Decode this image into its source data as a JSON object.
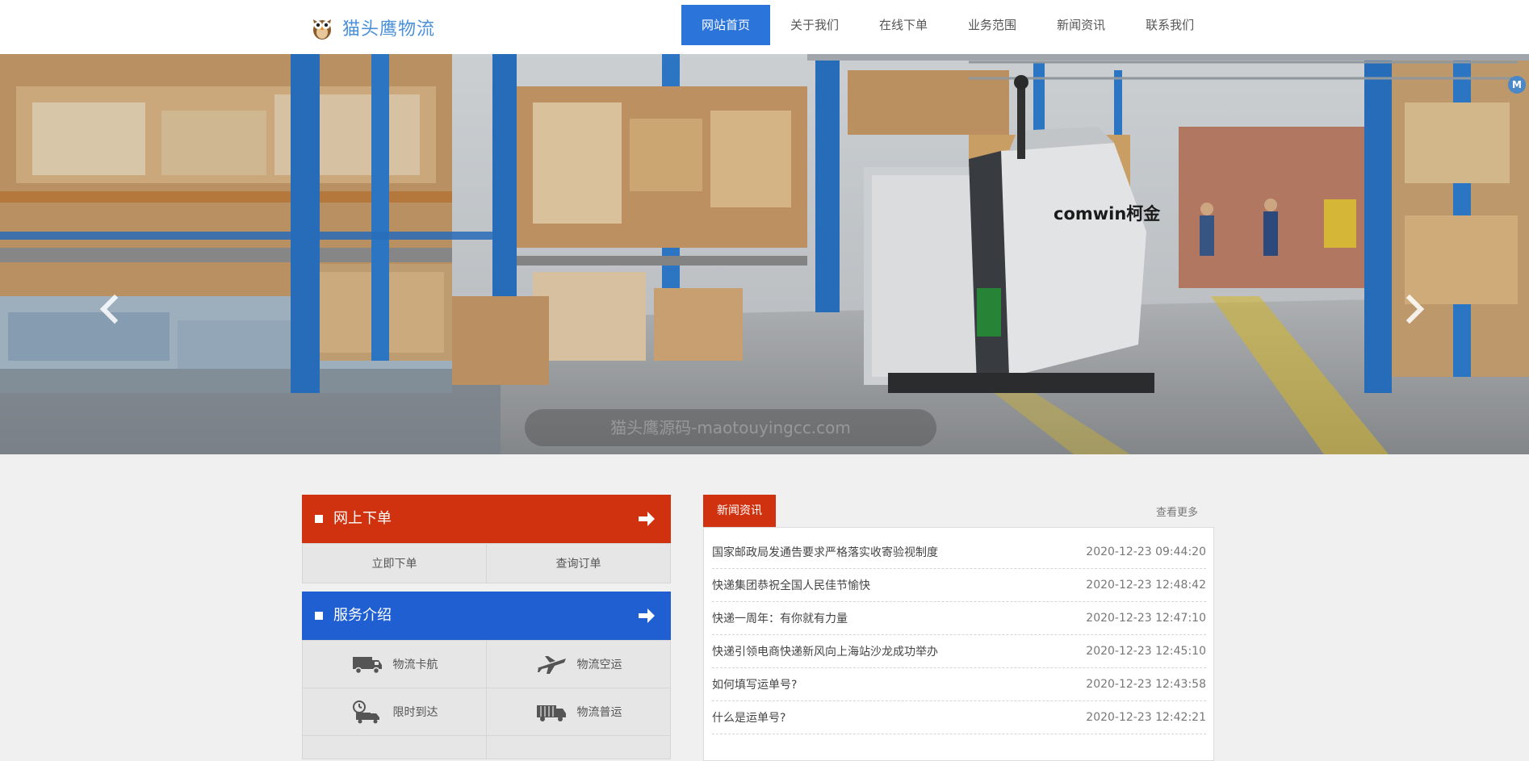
{
  "header": {
    "logo_text": "猫头鹰物流",
    "nav": [
      {
        "label": "网站首页",
        "active": true
      },
      {
        "label": "关于我们",
        "active": false
      },
      {
        "label": "在线下单",
        "active": false
      },
      {
        "label": "业务范围",
        "active": false
      },
      {
        "label": "新闻资讯",
        "active": false
      },
      {
        "label": "联系我们",
        "active": false
      }
    ]
  },
  "banner": {
    "truck_brand": "comwin柯金",
    "watermark": "猫头鹰源码-maotouyingcc.com",
    "slide_count": 3,
    "active_slide": 1,
    "side_badge": "M"
  },
  "order_panel": {
    "title": "网上下单",
    "color": "#d0310f",
    "buttons": [
      "立即下单",
      "查询订单"
    ]
  },
  "service_panel": {
    "title": "服务介绍",
    "color": "#1f5fd1",
    "items": [
      {
        "label": "物流卡航",
        "icon": "truck-icon"
      },
      {
        "label": "物流空运",
        "icon": "airplane-icon"
      },
      {
        "label": "限时到达",
        "icon": "clock-truck-icon"
      },
      {
        "label": "物流普运",
        "icon": "cargo-truck-icon"
      }
    ]
  },
  "news": {
    "tab_label": "新闻资讯",
    "more_label": "查看更多",
    "items": [
      {
        "title": "国家邮政局发通告要求严格落实收寄验视制度",
        "date": "2020-12-23 09:44:20"
      },
      {
        "title": "快递集团恭祝全国人民佳节愉快",
        "date": "2020-12-23 12:48:42"
      },
      {
        "title": "快递一周年：有你就有力量",
        "date": "2020-12-23 12:47:10"
      },
      {
        "title": "快递引领电商快递新风向上海站沙龙成功举办",
        "date": "2020-12-23 12:45:10"
      },
      {
        "title": "如何填写运单号?",
        "date": "2020-12-23 12:43:58"
      },
      {
        "title": "什么是运单号?",
        "date": "2020-12-23 12:42:21"
      }
    ]
  }
}
